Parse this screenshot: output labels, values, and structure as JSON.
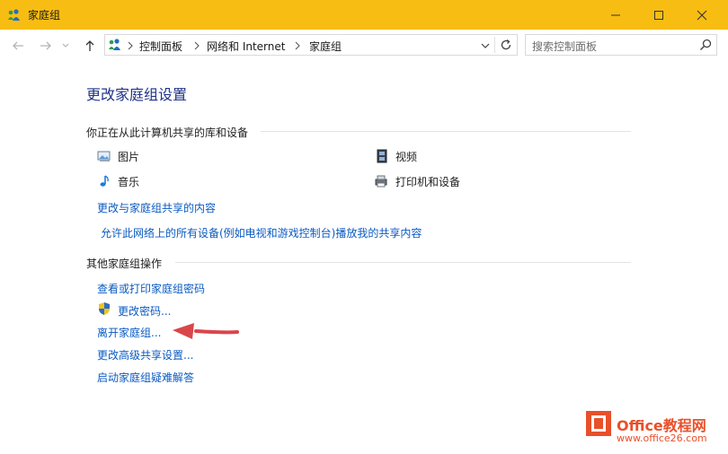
{
  "window": {
    "title": "家庭组"
  },
  "address": {
    "breadcrumbs": [
      "控制面板",
      "网络和 Internet",
      "家庭组"
    ],
    "search_placeholder": "搜索控制面板"
  },
  "main": {
    "page_title": "更改家庭组设置",
    "shared_section": {
      "heading": "你正在从此计算机共享的库和设备",
      "items": [
        {
          "label": "图片",
          "icon": "pictures-icon"
        },
        {
          "label": "视频",
          "icon": "videos-icon"
        },
        {
          "label": "音乐",
          "icon": "music-icon"
        },
        {
          "label": "打印机和设备",
          "icon": "printer-icon"
        }
      ],
      "links": [
        "更改与家庭组共享的内容",
        "允许此网络上的所有设备(例如电视和游戏控制台)播放我的共享内容"
      ]
    },
    "other_section": {
      "heading": "其他家庭组操作",
      "links": [
        "查看或打印家庭组密码",
        "更改密码...",
        "离开家庭组...",
        "更改高级共享设置...",
        "启动家庭组疑难解答"
      ]
    }
  },
  "watermark": {
    "brand": "Office教程网",
    "url": "www.office26.com"
  },
  "colors": {
    "titlebar": "#f8bd12",
    "link": "#0b5bc2",
    "heading": "#1e3287",
    "arrow": "#d9464a"
  }
}
